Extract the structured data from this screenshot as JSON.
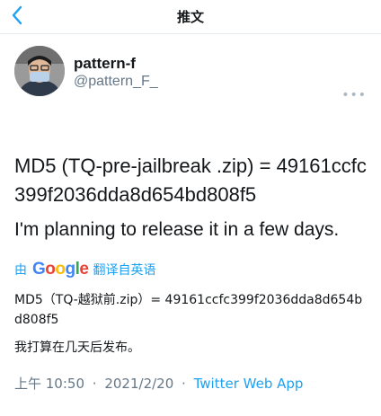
{
  "header": {
    "title": "推文",
    "back_icon": "chevron-left-icon"
  },
  "author": {
    "display_name": "pattern-f",
    "handle": "@pattern_F_",
    "more_icon": "more-dots-icon"
  },
  "tweet": {
    "line1": "MD5 (TQ-pre-jailbreak .zip) = 49161ccfc399f2036dda8d654bd808f5",
    "line2": "I'm planning to release it in a few days."
  },
  "translation": {
    "by": "由",
    "logo": "Google",
    "action": "翻译自英语",
    "line1": "MD5（TQ-越狱前.zip）= 49161ccfc399f2036dda8d654bd808f5",
    "line2": "我打算在几天后发布。"
  },
  "meta": {
    "time": "上午 10:50",
    "date": "2021/2/20",
    "separator": "·",
    "app": "Twitter Web App"
  },
  "colors": {
    "accent": "#1da1f2",
    "secondary_text": "#657786"
  }
}
